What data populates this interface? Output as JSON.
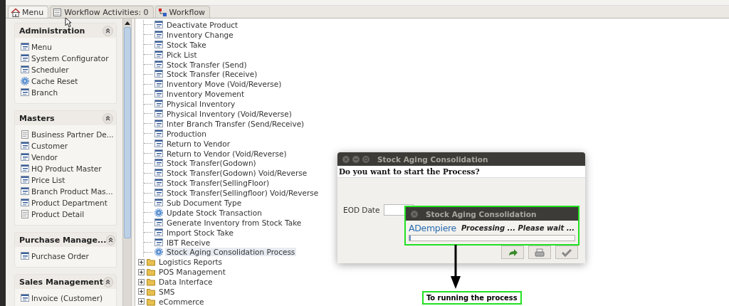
{
  "tabs": [
    {
      "label": "Menu",
      "selected": true
    },
    {
      "label": "Workflow Activities: 0",
      "selected": false
    },
    {
      "label": "Workflow",
      "selected": false
    }
  ],
  "sidebar": {
    "sections": [
      {
        "title": "Administration",
        "expanded": true,
        "items": [
          {
            "label": "Menu",
            "kind": "window"
          },
          {
            "label": "System Configurator",
            "kind": "window"
          },
          {
            "label": "Scheduler",
            "kind": "window"
          },
          {
            "label": "Cache Reset",
            "kind": "process"
          },
          {
            "label": "Branch",
            "kind": "window"
          }
        ]
      },
      {
        "title": "Masters",
        "expanded": true,
        "items": [
          {
            "label": "Business Partner De...",
            "kind": "report"
          },
          {
            "label": "Customer",
            "kind": "window"
          },
          {
            "label": "Vendor",
            "kind": "window"
          },
          {
            "label": "HQ Product Master",
            "kind": "window"
          },
          {
            "label": "Price List",
            "kind": "window"
          },
          {
            "label": "Branch Product Mas...",
            "kind": "window"
          },
          {
            "label": "Product Department",
            "kind": "window"
          },
          {
            "label": "Product Detail",
            "kind": "report"
          }
        ]
      },
      {
        "title": "Purchase Manage...",
        "expanded": true,
        "items": [
          {
            "label": "Purchase Order",
            "kind": "window"
          }
        ]
      },
      {
        "title": "Sales Management",
        "expanded": true,
        "items": [
          {
            "label": "Invoice (Customer)",
            "kind": "window"
          }
        ]
      }
    ]
  },
  "tree": {
    "items": [
      {
        "label": "Deactivate Product",
        "kind": "window",
        "selected": false
      },
      {
        "label": "Inventory Change",
        "kind": "window",
        "selected": false
      },
      {
        "label": "Stock Take",
        "kind": "window",
        "selected": false
      },
      {
        "label": "Pick List",
        "kind": "window",
        "selected": false
      },
      {
        "label": "Stock Transfer (Send)",
        "kind": "window",
        "selected": false
      },
      {
        "label": "Stock Transfer (Receive)",
        "kind": "window",
        "selected": false
      },
      {
        "label": "Inventory Move (Void/Reverse)",
        "kind": "window",
        "selected": false
      },
      {
        "label": "Inventory Movement",
        "kind": "window",
        "selected": false
      },
      {
        "label": "Physical Inventory",
        "kind": "window",
        "selected": false
      },
      {
        "label": "Physical Inventory (Void/Reverse)",
        "kind": "window",
        "selected": false
      },
      {
        "label": "Inter Branch Transfer (Send/Receive)",
        "kind": "window",
        "selected": false
      },
      {
        "label": "Production",
        "kind": "window",
        "selected": false
      },
      {
        "label": "Return to Vendor",
        "kind": "window",
        "selected": false
      },
      {
        "label": "Return to Vendor (Void/Reverse)",
        "kind": "window",
        "selected": false
      },
      {
        "label": "Stock Transfer(Godown)",
        "kind": "window",
        "selected": false
      },
      {
        "label": "Stock Transfer(Godown) Void/Reverse",
        "kind": "window",
        "selected": false
      },
      {
        "label": "Stock Transfer(SellingFloor)",
        "kind": "window",
        "selected": false
      },
      {
        "label": "Stock Transfer(Sellingfloor) Void/Reverse",
        "kind": "window",
        "selected": false
      },
      {
        "label": "Sub Document Type",
        "kind": "window",
        "selected": false
      },
      {
        "label": "Update Stock Transaction",
        "kind": "process",
        "selected": false
      },
      {
        "label": "Generate Inventory from Stock Take",
        "kind": "window",
        "selected": false
      },
      {
        "label": "Import Stock Take",
        "kind": "window",
        "selected": false
      },
      {
        "label": "IBT Receive",
        "kind": "window",
        "selected": false
      },
      {
        "label": "Stock Aging Consolidation Process",
        "kind": "process",
        "selected": true
      }
    ],
    "folders": [
      {
        "label": "Logistics Reports",
        "expanded": false
      },
      {
        "label": "POS Management",
        "expanded": false
      },
      {
        "label": "Data Interface",
        "expanded": false
      },
      {
        "label": "SMS",
        "expanded": false
      },
      {
        "label": "eCommerce",
        "expanded": false
      }
    ]
  },
  "dialog": {
    "title": "Stock Aging Consolidation",
    "question": "Do you want to start the Process?",
    "field": {
      "label": "EOD Date"
    }
  },
  "progress_dialog": {
    "title": "Stock Aging Consolidation",
    "logo": "ADempiere",
    "message": "Processing ... Please wait ...",
    "level": 0.01
  },
  "annotation": {
    "label": "To running the process"
  }
}
